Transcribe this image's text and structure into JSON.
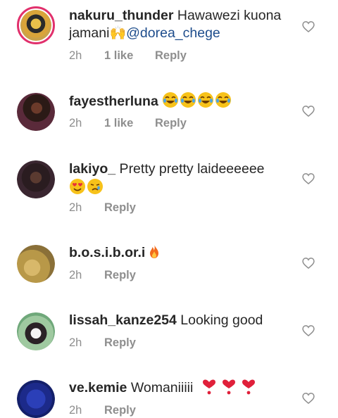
{
  "comments": [
    {
      "username": "nakuru_thunder",
      "text_line1": " Hawawezi kuona",
      "text_line2": "jamani",
      "emoji": "🙌",
      "mention": "@dorea_chege",
      "time": "2h",
      "likes": "1 like",
      "reply": "Reply"
    },
    {
      "username": "fayestherluna",
      "emoji": "😂😂😂😂",
      "time": "2h",
      "likes": "1 like",
      "reply": "Reply"
    },
    {
      "username": "lakiyo_",
      "text_line1": " Pretty pretty laideeeeee",
      "emoji": "😍😢",
      "time": "2h",
      "reply": "Reply"
    },
    {
      "username": "b.o.s.i.b.or.i",
      "emoji": "🔥",
      "time": "2h",
      "reply": "Reply"
    },
    {
      "username": "lissah_kanze254",
      "text_line1": " Looking good",
      "time": "2h",
      "reply": "Reply"
    },
    {
      "username": "ve.kemie",
      "text_line1": " Womaniiiii",
      "emoji": "❣️❣️❣️",
      "time": "2h",
      "reply": "Reply"
    }
  ],
  "icons": {
    "like": "heart-outline-icon"
  },
  "colors": {
    "username": "#262626",
    "meta": "#8e8e8e",
    "mention": "#1e4d8c",
    "story_ring": "#e1306c"
  }
}
